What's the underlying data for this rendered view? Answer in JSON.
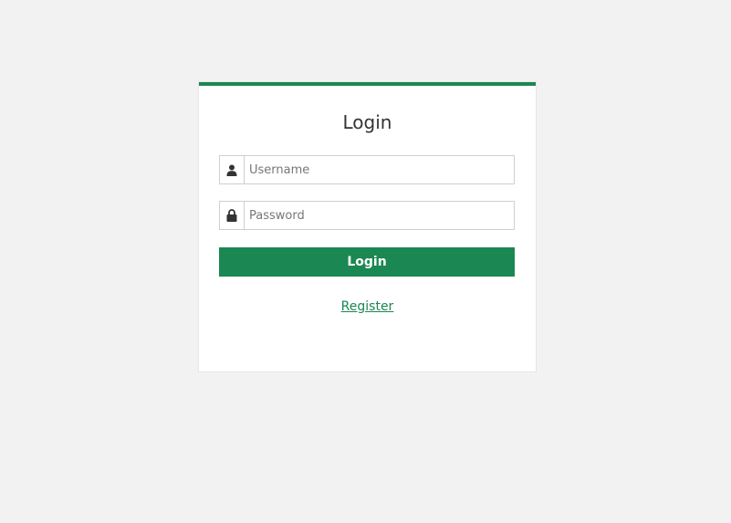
{
  "login_form": {
    "title": "Login",
    "username": {
      "icon": "user-icon",
      "placeholder": "Username",
      "value": ""
    },
    "password": {
      "icon": "lock-icon",
      "placeholder": "Password",
      "value": ""
    },
    "submit_label": "Login",
    "register_link": "Register"
  },
  "colors": {
    "accent": "#1b8752",
    "background": "#f2f2f2",
    "card": "#ffffff"
  }
}
